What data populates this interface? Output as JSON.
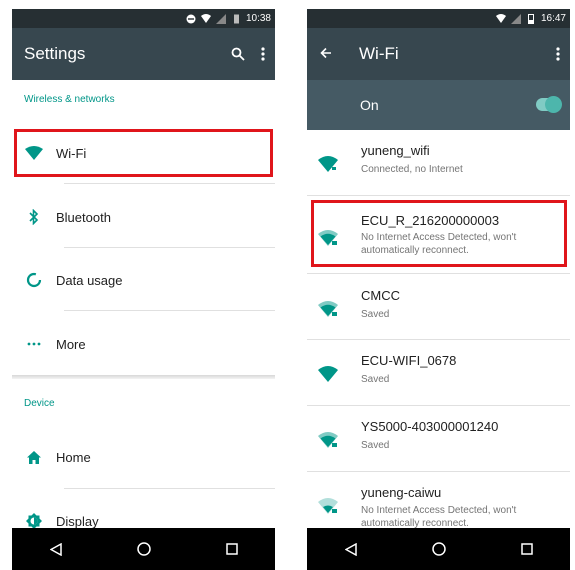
{
  "left_screen": {
    "status": {
      "time": "10:38"
    },
    "appbar": {
      "title": "Settings",
      "search_icon": "search-icon",
      "more_icon": "overflow-menu-icon"
    },
    "section_wireless": "Wireless & networks",
    "items": [
      {
        "label": "Wi-Fi",
        "icon": "wifi-icon"
      },
      {
        "label": "Bluetooth",
        "icon": "bluetooth-icon"
      },
      {
        "label": "Data usage",
        "icon": "data-usage-icon"
      },
      {
        "label": "More",
        "icon": "more-dots-icon"
      }
    ],
    "section_device": "Device",
    "device_items": [
      {
        "label": "Home",
        "icon": "home-icon"
      },
      {
        "label": "Display",
        "icon": "display-brightness-icon"
      }
    ]
  },
  "right_screen": {
    "status": {
      "time": "16:47"
    },
    "appbar": {
      "title": "Wi-Fi",
      "back_icon": "back-arrow-icon",
      "more_icon": "overflow-menu-icon"
    },
    "toggle": {
      "label": "On",
      "state": "on"
    },
    "networks": [
      {
        "ssid": "yuneng_wifi",
        "status": "Connected, no Internet"
      },
      {
        "ssid": "ECU_R_216200000003",
        "status": "No Internet Access Detected, won't automatically reconnect."
      },
      {
        "ssid": "CMCC",
        "status": "Saved"
      },
      {
        "ssid": "ECU-WIFI_0678",
        "status": "Saved"
      },
      {
        "ssid": "YS5000-403000001240",
        "status": "Saved"
      },
      {
        "ssid": "yuneng-caiwu",
        "status": "No Internet Access Detected, won't automatically reconnect."
      }
    ]
  },
  "colors": {
    "accent": "#009688",
    "appbar": "#37474f",
    "statusbar": "#262f33",
    "highlight": "#e0151b"
  }
}
